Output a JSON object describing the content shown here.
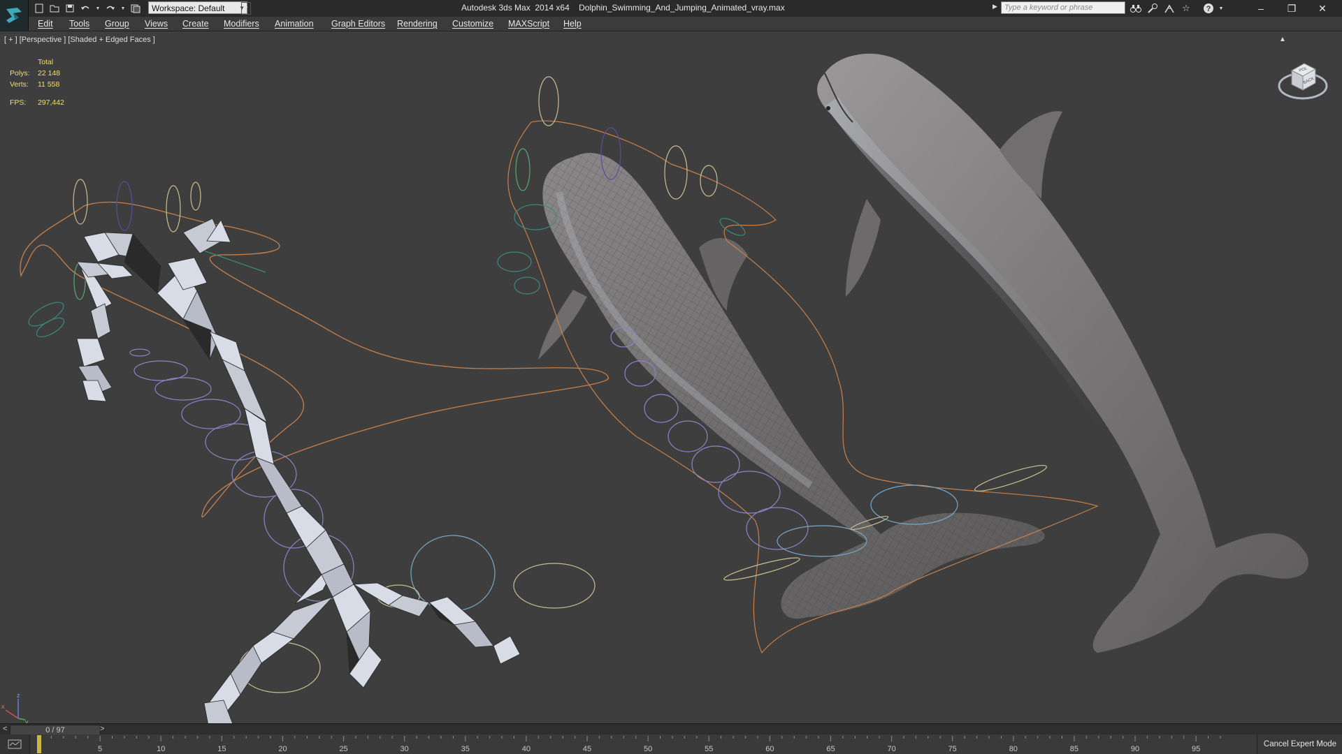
{
  "titlebar": {
    "workspace_label": "Workspace: Default",
    "title": "Autodesk 3ds Max  2014 x64    Dolphin_Swimming_And_Jumping_Animated_vray.max",
    "search_placeholder": "Type a keyword or phrase",
    "window_controls": {
      "minimize": "–",
      "maximize": "❐",
      "close": "✕"
    }
  },
  "menubar": {
    "items": [
      {
        "label": "Edit"
      },
      {
        "label": "Tools"
      },
      {
        "label": "Group"
      },
      {
        "label": "Views"
      },
      {
        "label": "Create"
      },
      {
        "label": "Modifiers"
      },
      {
        "label": "Animation"
      },
      {
        "label": "Graph Editors"
      },
      {
        "label": "Rendering"
      },
      {
        "label": "Customize"
      },
      {
        "label": "MAXScript"
      },
      {
        "label": "Help"
      }
    ]
  },
  "viewport": {
    "label": "[ + ] [Perspective ] [Shaded + Edged Faces ]",
    "stats": {
      "header": "Total",
      "polys_label": "Polys:",
      "polys_value": "22 148",
      "verts_label": "Verts:",
      "verts_value": "11 558",
      "fps_label": "FPS:",
      "fps_value": "297,442"
    },
    "viewcube": {
      "top_label": "POL",
      "face_label": "BACK"
    }
  },
  "timeline": {
    "frame_display": "0 / 97",
    "prev_label": "<",
    "next_label": ">",
    "ticks": [
      "0",
      "5",
      "10",
      "15",
      "20",
      "25",
      "30",
      "35",
      "40",
      "45",
      "50",
      "55",
      "60",
      "65",
      "70",
      "75",
      "80",
      "85",
      "90",
      "95"
    ],
    "current_frame": 0,
    "total_frames": 97
  },
  "status": {
    "cancel_expert_label": "Cancel Expert Mode"
  },
  "colors": {
    "viewport_bg": "#3e3e3e",
    "stats_text": "#f0e060",
    "spline_orange": "#c8804a",
    "helper_purple": "#8c84c8",
    "helper_blue": "#78a8c8",
    "helper_yellow": "#c8c090",
    "helper_green": "#5aa878",
    "bone_white": "#d8dce6",
    "dolphin_gray": "#7a7878"
  }
}
